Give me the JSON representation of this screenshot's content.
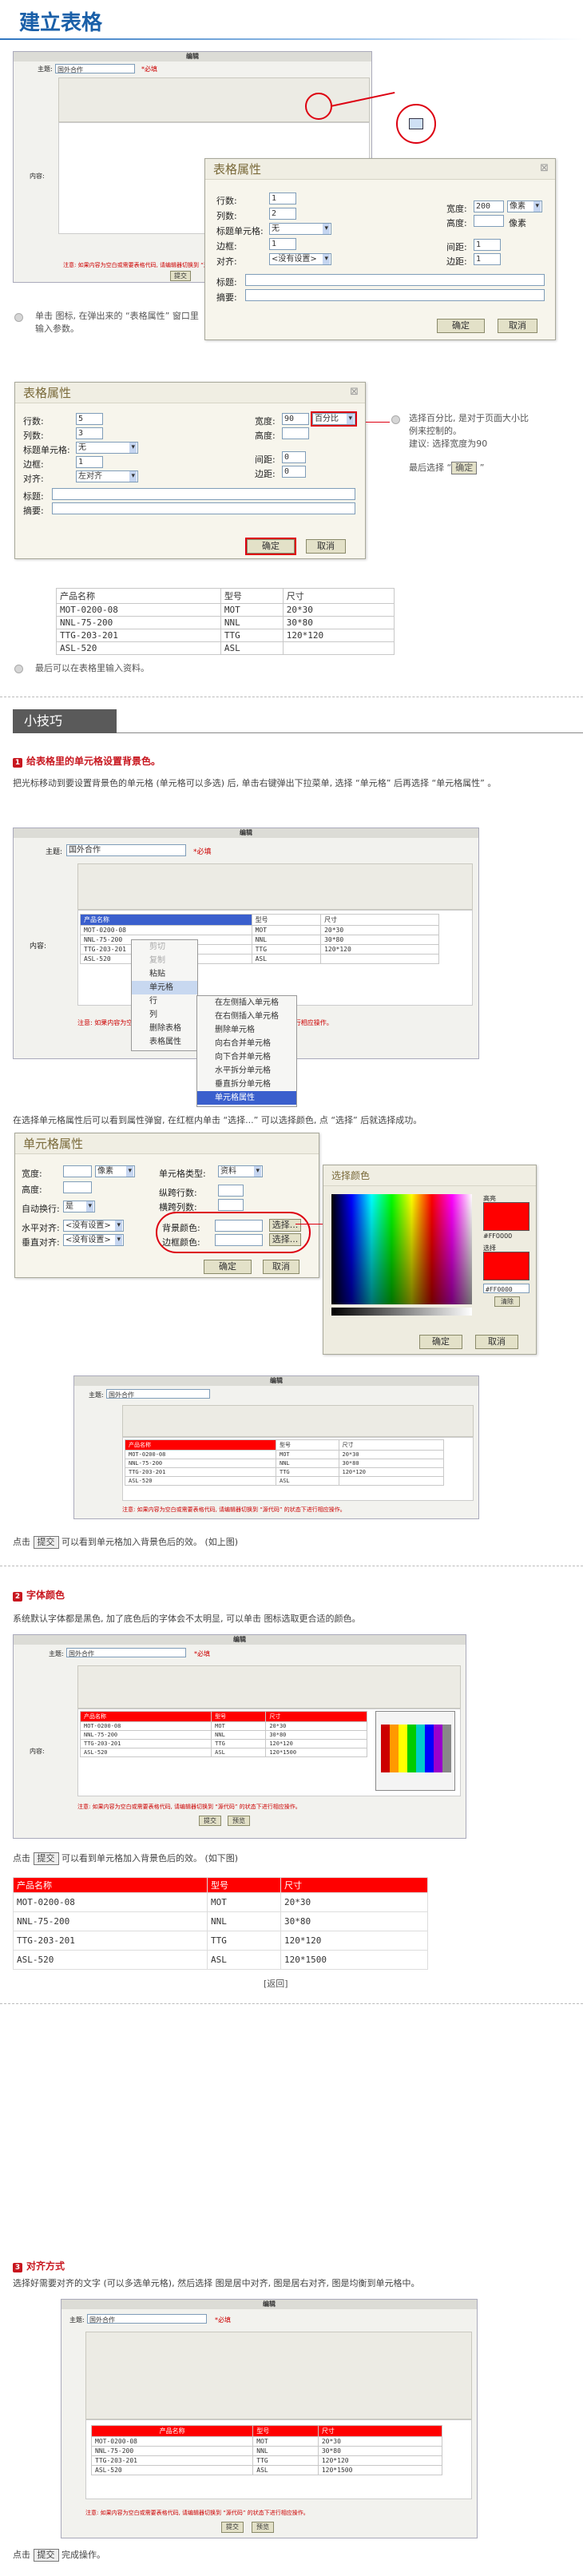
{
  "page_title": "建立表格",
  "editor": {
    "header": "编辑",
    "topic_label": "主题:",
    "topic_value": "国外合作",
    "required": "*必填",
    "content_label": "内容:",
    "submit": "提交",
    "preview": "预览",
    "notice": "注意: 如果内容为空白或需要表格代码, 请编辑器切换到 “源代码” 的状态下进行相应操作。"
  },
  "table_props": {
    "title": "表格属性",
    "rows_label": "行数:",
    "rows_value": "1",
    "rows_value2": "5",
    "cols_label": "列数:",
    "cols_value": "2",
    "cols_value2": "3",
    "header_label": "标题单元格:",
    "header_value": "无",
    "border_label": "边框:",
    "border_value": "1",
    "align_label": "对齐:",
    "align_value": "<没有设置>",
    "align_value2": "左对齐",
    "width_label": "宽度:",
    "width_value": "200",
    "width_value2": "90",
    "width_unit": "像素",
    "width_unit2": "百分比",
    "height_label": "高度:",
    "height_unit": "像素",
    "cellspacing_label": "间距:",
    "cellspacing_value": "1",
    "cellspacing_value2": "0",
    "cellpadding_label": "边距:",
    "cellpadding_value": "1",
    "cellpadding_value2": "0",
    "caption_label": "标题:",
    "summary_label": "摘要:",
    "ok": "确定",
    "cancel": "取消"
  },
  "step1_note": "单击 图标, 在弹出来的 “表格属性” 窗口里输入参数。",
  "step2_note": {
    "line1": "选择百分比, 是对于页面大小比",
    "line2": "例来控制的。",
    "line3": "建议: 选择宽度为90",
    "line4": "最后选择 “",
    "line4_end": " ”"
  },
  "product_table": {
    "headers": [
      "产品名称",
      "型号",
      "尺寸"
    ],
    "rows": [
      [
        "MOT-0200-08",
        "MOT",
        "20*30"
      ],
      [
        "NNL-75-200",
        "NNL",
        "30*80"
      ],
      [
        "TTG-203-201",
        "TTG",
        "120*120"
      ],
      [
        "ASL-520",
        "ASL",
        ""
      ]
    ]
  },
  "step3_note": "最后可以在表格里输入资料。",
  "tips_tab": "小技巧",
  "tip1": {
    "heading": "给表格里的单元格设置背景色。",
    "para": "把光标移动到要设置背景色的单元格 (单元格可以多选) 后, 单击右键弹出下拉菜单, 选择 “单元格” 后再选择 “单元格属性” 。"
  },
  "context_menu": {
    "items": [
      "剪切",
      "复制",
      "粘贴",
      "单元格",
      "行",
      "列",
      "删除表格",
      "表格属性"
    ],
    "submenu": [
      "在左侧插入单元格",
      "在右侧插入单元格",
      "删除单元格",
      "向右合并单元格",
      "向下合并单元格",
      "水平拆分单元格",
      "垂直拆分单元格",
      "单元格属性"
    ]
  },
  "tip1_para2": "在选择单元格属性后可以看到属性弹窗, 在红框内单击 “选择...” 可以选择颜色, 点 “选择” 后就选择成功。",
  "cell_props": {
    "title": "单元格属性",
    "width_label": "宽度:",
    "width_unit": "像素",
    "height_label": "高度:",
    "wrap_label": "自动换行:",
    "wrap_value": "是",
    "halign_label": "水平对齐:",
    "halign_value": "<没有设置>",
    "valign_label": "垂直对齐:",
    "valign_value": "<没有设置>",
    "type_label": "单元格类型:",
    "type_value": "资料",
    "rowspan_label": "纵跨行数:",
    "colspan_label": "横跨列数:",
    "bgcolor_label": "背景颜色:",
    "bordercolor_label": "边框颜色:",
    "choose": "选择...",
    "ok": "确定",
    "cancel": "取消"
  },
  "color_picker": {
    "title": "选择颜色",
    "highlight_label": "高亮",
    "highlight_value": "#FF0000",
    "selected_label": "选择",
    "selected_value": "#FF0000",
    "clear": "清除",
    "ok": "确定",
    "cancel": "取消"
  },
  "tip1_end": {
    "pre": "点击",
    "btn": "提交",
    "post": "可以看到单元格加入背景色后的效。 (如上图)"
  },
  "tip2": {
    "heading": "字体颜色",
    "para": "系统默认字体都是黑色, 加了底色后的字体会不太明显, 可以单击 图标选取更合适的颜色。",
    "end_post": "可以看到单元格加入背景色后的效。 (如下图)"
  },
  "red_table": {
    "headers": [
      "产品名称",
      "型号",
      "尺寸"
    ],
    "rows": [
      [
        "MOT-0200-08",
        "MOT",
        "20*30"
      ],
      [
        "NNL-75-200",
        "NNL",
        "30*80"
      ],
      [
        "TTG-203-201",
        "TTG",
        "120*120"
      ],
      [
        "ASL-520",
        "ASL",
        "120*1500"
      ]
    ]
  },
  "return_link": "[返回]",
  "tip3": {
    "heading": "对齐方式",
    "para": "选择好需要对齐的文字 (可以多选单元格), 然后选择 图是居中对齐, 图是居右对齐, 图是均衡到单元格中。",
    "end_post": "完成操作。"
  },
  "colors": {
    "accent_red": "#c8171f",
    "title_blue": "#1a5fa8"
  }
}
